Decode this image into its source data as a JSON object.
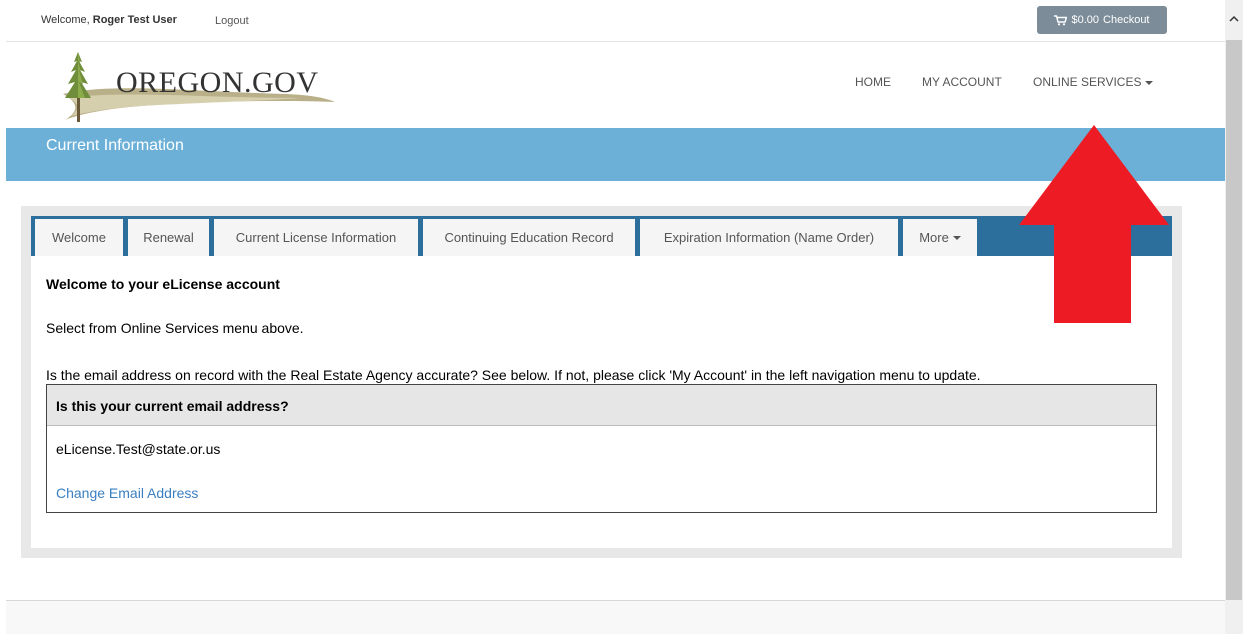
{
  "topbar": {
    "welcome_prefix": "Welcome,",
    "user_name": "Roger Test User",
    "logout": "Logout",
    "cart_amount": "$0.00",
    "checkout": "Checkout"
  },
  "header": {
    "logo_text": "OREGON.GOV",
    "nav": {
      "home": "HOME",
      "my_account": "MY ACCOUNT",
      "online_services": "ONLINE SERVICES"
    }
  },
  "banner": {
    "title": "Current Information"
  },
  "tabs": [
    {
      "label": "Welcome"
    },
    {
      "label": "Renewal"
    },
    {
      "label": "Current License Information"
    },
    {
      "label": "Continuing Education Record"
    },
    {
      "label": "Expiration Information (Name Order)"
    },
    {
      "label": "More"
    }
  ],
  "content": {
    "heading": "Welcome to your eLicense account",
    "line1": "Select from Online Services menu above.",
    "line2": "Is the email address on record with the Real Estate Agency accurate? See below. If not, please click 'My Account' in the left navigation menu to update.",
    "email_panel": {
      "title": "Is this your current email address?",
      "email": "eLicense.Test@state.or.us",
      "change_link": "Change Email Address"
    }
  },
  "colors": {
    "banner": "#6cb0d8",
    "tabbar": "#2c6f9d",
    "cart_button": "#7c8c98",
    "link": "#3a7fc1",
    "annotation_arrow": "#ed1c24"
  },
  "icons": [
    "shopping-cart-icon",
    "caret-down-icon",
    "scroll-up-icon",
    "tree-logo-icon",
    "red-arrow-annotation"
  ]
}
